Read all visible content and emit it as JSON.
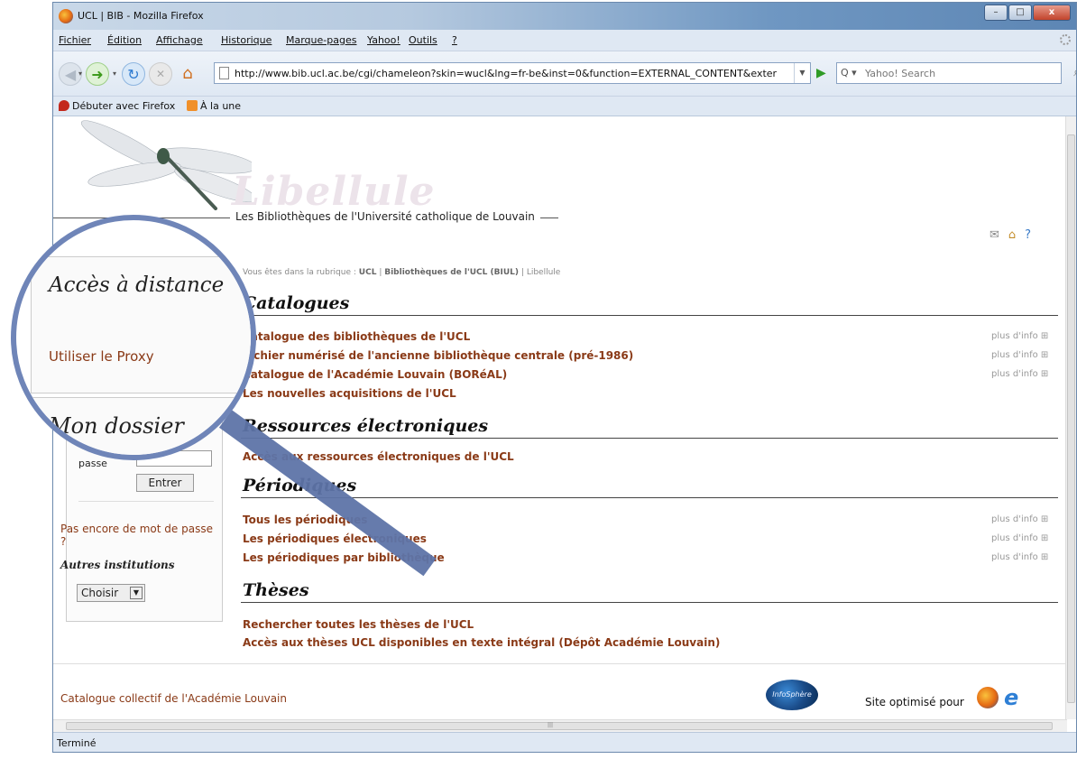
{
  "window": {
    "title": "UCL | BIB - Mozilla Firefox",
    "controls": {
      "minimize": "–",
      "maximize": "□",
      "close": "x"
    }
  },
  "menu": [
    "Fichier",
    "Édition",
    "Affichage",
    "Historique",
    "Marque-pages",
    "Yahoo!",
    "Outils",
    "?"
  ],
  "nav": {
    "url": "http://www.bib.ucl.ac.be/cgi/chameleon?skin=wucl&lng=fr-be&inst=0&function=EXTERNAL_CONTENT&exter",
    "search_engine": "Q ▾",
    "search_placeholder": "Yahoo! Search"
  },
  "bookmarks": [
    "Débuter avec Firefox",
    "À la une"
  ],
  "page": {
    "logo_word": "Libellule",
    "subtitle": "Les Bibliothèques de l'Université catholique de Louvain",
    "breadcrumb_prefix": "Vous êtes dans la rubrique :",
    "breadcrumb_ucl": "UCL",
    "breadcrumb_sep": "|",
    "breadcrumb_biul": "Bibliothèques de l'UCL (BIUL)",
    "breadcrumb_current": "Libellule",
    "more_label": "plus d'info ⊞",
    "sections": [
      {
        "title": "Catalogues",
        "links": [
          "Catalogue des bibliothèques de l'UCL",
          "Fichier numérisé de l'ancienne bibliothèque centrale (pré-1986)",
          "Catalogue de l'Académie Louvain (BORéAL)",
          "Les nouvelles acquisitions de l'UCL"
        ]
      },
      {
        "title": "Ressources électroniques",
        "links": [
          "Accès aux ressources électroniques de l'UCL"
        ]
      },
      {
        "title": "Périodiques",
        "links": [
          "Tous les périodiques",
          "Les périodiques électroniques",
          "Les périodiques par bibliothèque"
        ]
      },
      {
        "title": "Thèses",
        "links": [
          "Rechercher toutes les thèses de l'UCL",
          "Accès aux thèses UCL disponibles en texte intégral (Dépôt Académie Louvain)"
        ]
      }
    ],
    "sidebar": {
      "access_title": "Accès à distance",
      "proxy": "Utiliser le Proxy",
      "dossier_title": "Mon dossier",
      "password_label": "passe",
      "enter": "Entrer",
      "no_password": "Pas encore de mot de passe ?",
      "other_institutions": "Autres institutions",
      "choose": "Choisir"
    },
    "footer_left": "Catalogue collectif de l'Académie Louvain",
    "infosphere": "InfoSphère",
    "optimised": "Site optimisé pour"
  },
  "status": "Terminé",
  "colors": {
    "link": "#8a3a17",
    "lens": "#6f85b8"
  }
}
